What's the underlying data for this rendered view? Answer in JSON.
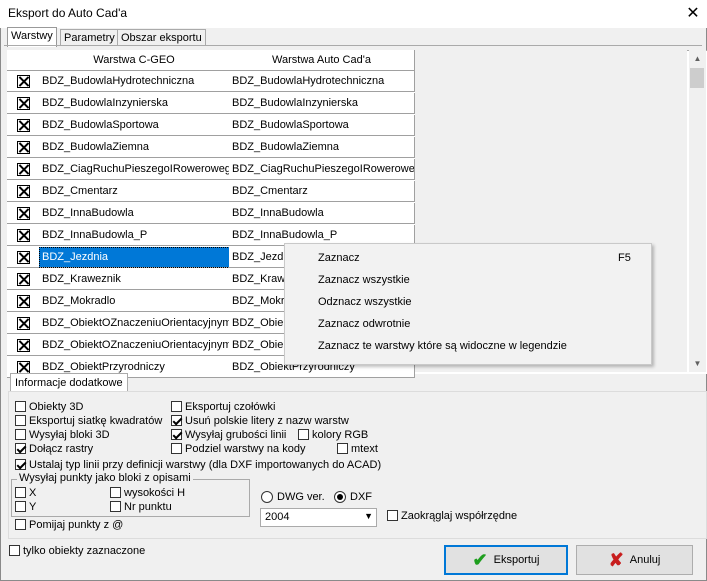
{
  "window": {
    "title": "Eksport do Auto Cad'a",
    "close": "✕"
  },
  "tabs": [
    "Warstwy",
    "Parametry",
    "Obszar eksportu"
  ],
  "grid": {
    "headers": [
      "Warstwa C-GEO",
      "Warstwa Auto Cad'a"
    ],
    "rows": [
      {
        "checked": true,
        "cgeo": "BDZ_BudowlaHydrotechniczna",
        "acad": "BDZ_BudowlaHydrotechniczna"
      },
      {
        "checked": true,
        "cgeo": "BDZ_BudowlaInzynierska",
        "acad": "BDZ_BudowlaInzynierska"
      },
      {
        "checked": true,
        "cgeo": "BDZ_BudowlaSportowa",
        "acad": "BDZ_BudowlaSportowa"
      },
      {
        "checked": true,
        "cgeo": "BDZ_BudowlaZiemna",
        "acad": "BDZ_BudowlaZiemna"
      },
      {
        "checked": true,
        "cgeo": "BDZ_CiagRuchuPieszegoIRowerowego",
        "acad": "BDZ_CiagRuchuPieszegoIRowerowego"
      },
      {
        "checked": true,
        "cgeo": "BDZ_Cmentarz",
        "acad": "BDZ_Cmentarz"
      },
      {
        "checked": true,
        "cgeo": "BDZ_InnaBudowla",
        "acad": "BDZ_InnaBudowla"
      },
      {
        "checked": true,
        "cgeo": "BDZ_InnaBudowla_P",
        "acad": "BDZ_InnaBudowla_P"
      },
      {
        "checked": true,
        "cgeo": "BDZ_Jezdnia",
        "acad": "BDZ_Jezdnia",
        "selected": true
      },
      {
        "checked": true,
        "cgeo": "BDZ_Kraweznik",
        "acad": "BDZ_Kraweznik"
      },
      {
        "checked": true,
        "cgeo": "BDZ_Mokradlo",
        "acad": "BDZ_Mokradlo"
      },
      {
        "checked": true,
        "cgeo": "BDZ_ObiektOZnaczeniuOrientacyjnym",
        "acad": "BDZ_ObiektOZnaczeniuOrientacyjnym"
      },
      {
        "checked": true,
        "cgeo": "BDZ_ObiektOZnaczeniuOrientacyjnym",
        "acad": "BDZ_ObiektOZnaczeniuOrientacyjnym"
      },
      {
        "checked": true,
        "cgeo": "BDZ_ObiektPrzyrodniczy",
        "acad": "BDZ_ObiektPrzyrodniczy"
      }
    ]
  },
  "context_menu": [
    {
      "label": "Zaznacz",
      "shortcut": "F5"
    },
    {
      "label": "Zaznacz wszystkie",
      "shortcut": ""
    },
    {
      "label": "Odznacz wszystkie",
      "shortcut": ""
    },
    {
      "label": "Zaznacz odwrotnie",
      "shortcut": ""
    },
    {
      "label": "Zaznacz te warstwy które są widoczne  w legendzie",
      "shortcut": ""
    }
  ],
  "info": {
    "tab": "Informacje dodatkowe",
    "obiekty3d": {
      "label": "Obiekty  3D",
      "checked": false
    },
    "siatka": {
      "label": "Eksportuj siatkę kwadratów",
      "checked": false
    },
    "bloki3d": {
      "label": "Wysyłaj bloki 3D",
      "checked": false
    },
    "rastry": {
      "label": "Dołącz rastry",
      "checked": true
    },
    "czolowki": {
      "label": "Eksportuj czołówki",
      "checked": false
    },
    "polskie": {
      "label": "Usuń polskie litery z nazw warstw",
      "checked": true
    },
    "grubosci": {
      "label": "Wysyłaj grubości linii",
      "checked": true
    },
    "kolory": {
      "label": "kolory RGB",
      "checked": false
    },
    "podzial": {
      "label": "Podziel warstwy na kody",
      "checked": false
    },
    "mtext": {
      "label": "mtext",
      "checked": false
    },
    "typlinii": {
      "label": "Ustalaj typ linii przy definicji warstwy (dla DXF importowanych do ACAD)",
      "checked": true
    },
    "group_title": "Wysyłaj punkty jako bloki z opisami",
    "x": {
      "label": "X",
      "checked": false
    },
    "y": {
      "label": "Y",
      "checked": false
    },
    "wysokosci": {
      "label": "wysokości H",
      "checked": false
    },
    "nrpunktu": {
      "label": "Nr punktu",
      "checked": false
    },
    "pomijaj": {
      "label": "Pomijaj punkty z @",
      "checked": false
    },
    "dwg": {
      "label": "DWG ver.",
      "selected": false
    },
    "dxf": {
      "label": "DXF",
      "selected": true
    },
    "version": "2004",
    "zaokraglaj": {
      "label": "Zaokrąglaj współrzędne",
      "checked": false
    }
  },
  "bottom": {
    "tylko": {
      "label": "tylko obiekty zaznaczone",
      "checked": false
    },
    "export_label": "Eksportuj",
    "cancel_label": "Anuluj"
  },
  "colors": {
    "selection": "#0078d7",
    "ok_icon": "#1e9e1e",
    "cancel_icon": "#c81e1e"
  }
}
